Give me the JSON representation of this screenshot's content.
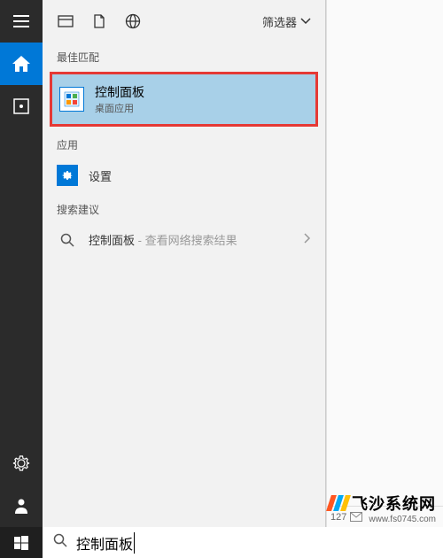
{
  "sidebar": {
    "items": [
      {
        "name": "menu"
      },
      {
        "name": "home"
      },
      {
        "name": "recent"
      }
    ],
    "bottomItems": [
      {
        "name": "settings-gear"
      },
      {
        "name": "user"
      }
    ]
  },
  "header": {
    "filterLabel": "筛选器"
  },
  "sections": {
    "bestMatch": "最佳匹配",
    "apps": "应用",
    "suggestions": "搜索建议"
  },
  "bestMatch": {
    "title": "控制面板",
    "subtitle": "桌面应用"
  },
  "appsList": [
    {
      "label": "设置"
    }
  ],
  "suggestionsList": [
    {
      "label": "控制面板",
      "note": " - 查看网络搜索结果"
    }
  ],
  "rightPanel": {
    "count": "127"
  },
  "search": {
    "value": "控制面板",
    "placeholder": ""
  },
  "watermark": {
    "brand": "飞沙系统网",
    "url": "www.fs0745.com"
  }
}
